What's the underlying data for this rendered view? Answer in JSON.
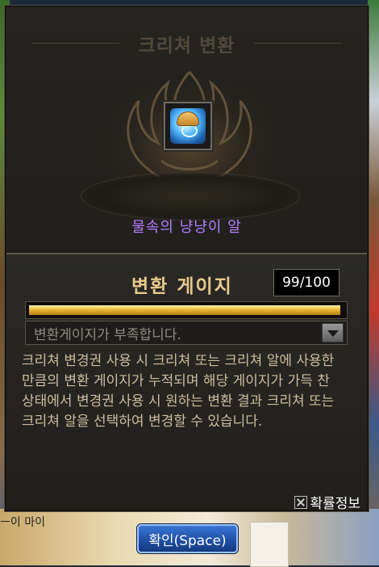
{
  "window": {
    "title": "크리쳐 변환"
  },
  "item": {
    "name": "물속의 냥냥이 알",
    "icon": "water-creature-egg-icon"
  },
  "gauge": {
    "title": "변환 게이지",
    "count": "99/100",
    "current": 99,
    "max": 100,
    "fill_fraction": 0.99
  },
  "dropdown": {
    "selected": "변환게이지가 부족합니다."
  },
  "description": "크리쳐 변경권 사용 시 크리쳐 또는 크리쳐 알에 사용한 만큼의 변환 게이지가 누적되며 해당 게이지가 가득 찬 상태에서 변경권 사용 시 원하는 변환 결과 크리쳐 또는 크리쳐 알을 선택하여 변경할 수 있습니다.",
  "probability_link": "확률정보",
  "confirm_button": "확인(Space)",
  "background": {
    "left_text": "ㅡ이 마이"
  },
  "colors": {
    "item_name": "#b37dff",
    "gauge_title": "#e8c98c",
    "gauge_fill": "#e9b73a",
    "confirm_button": "#1f4fa6"
  }
}
